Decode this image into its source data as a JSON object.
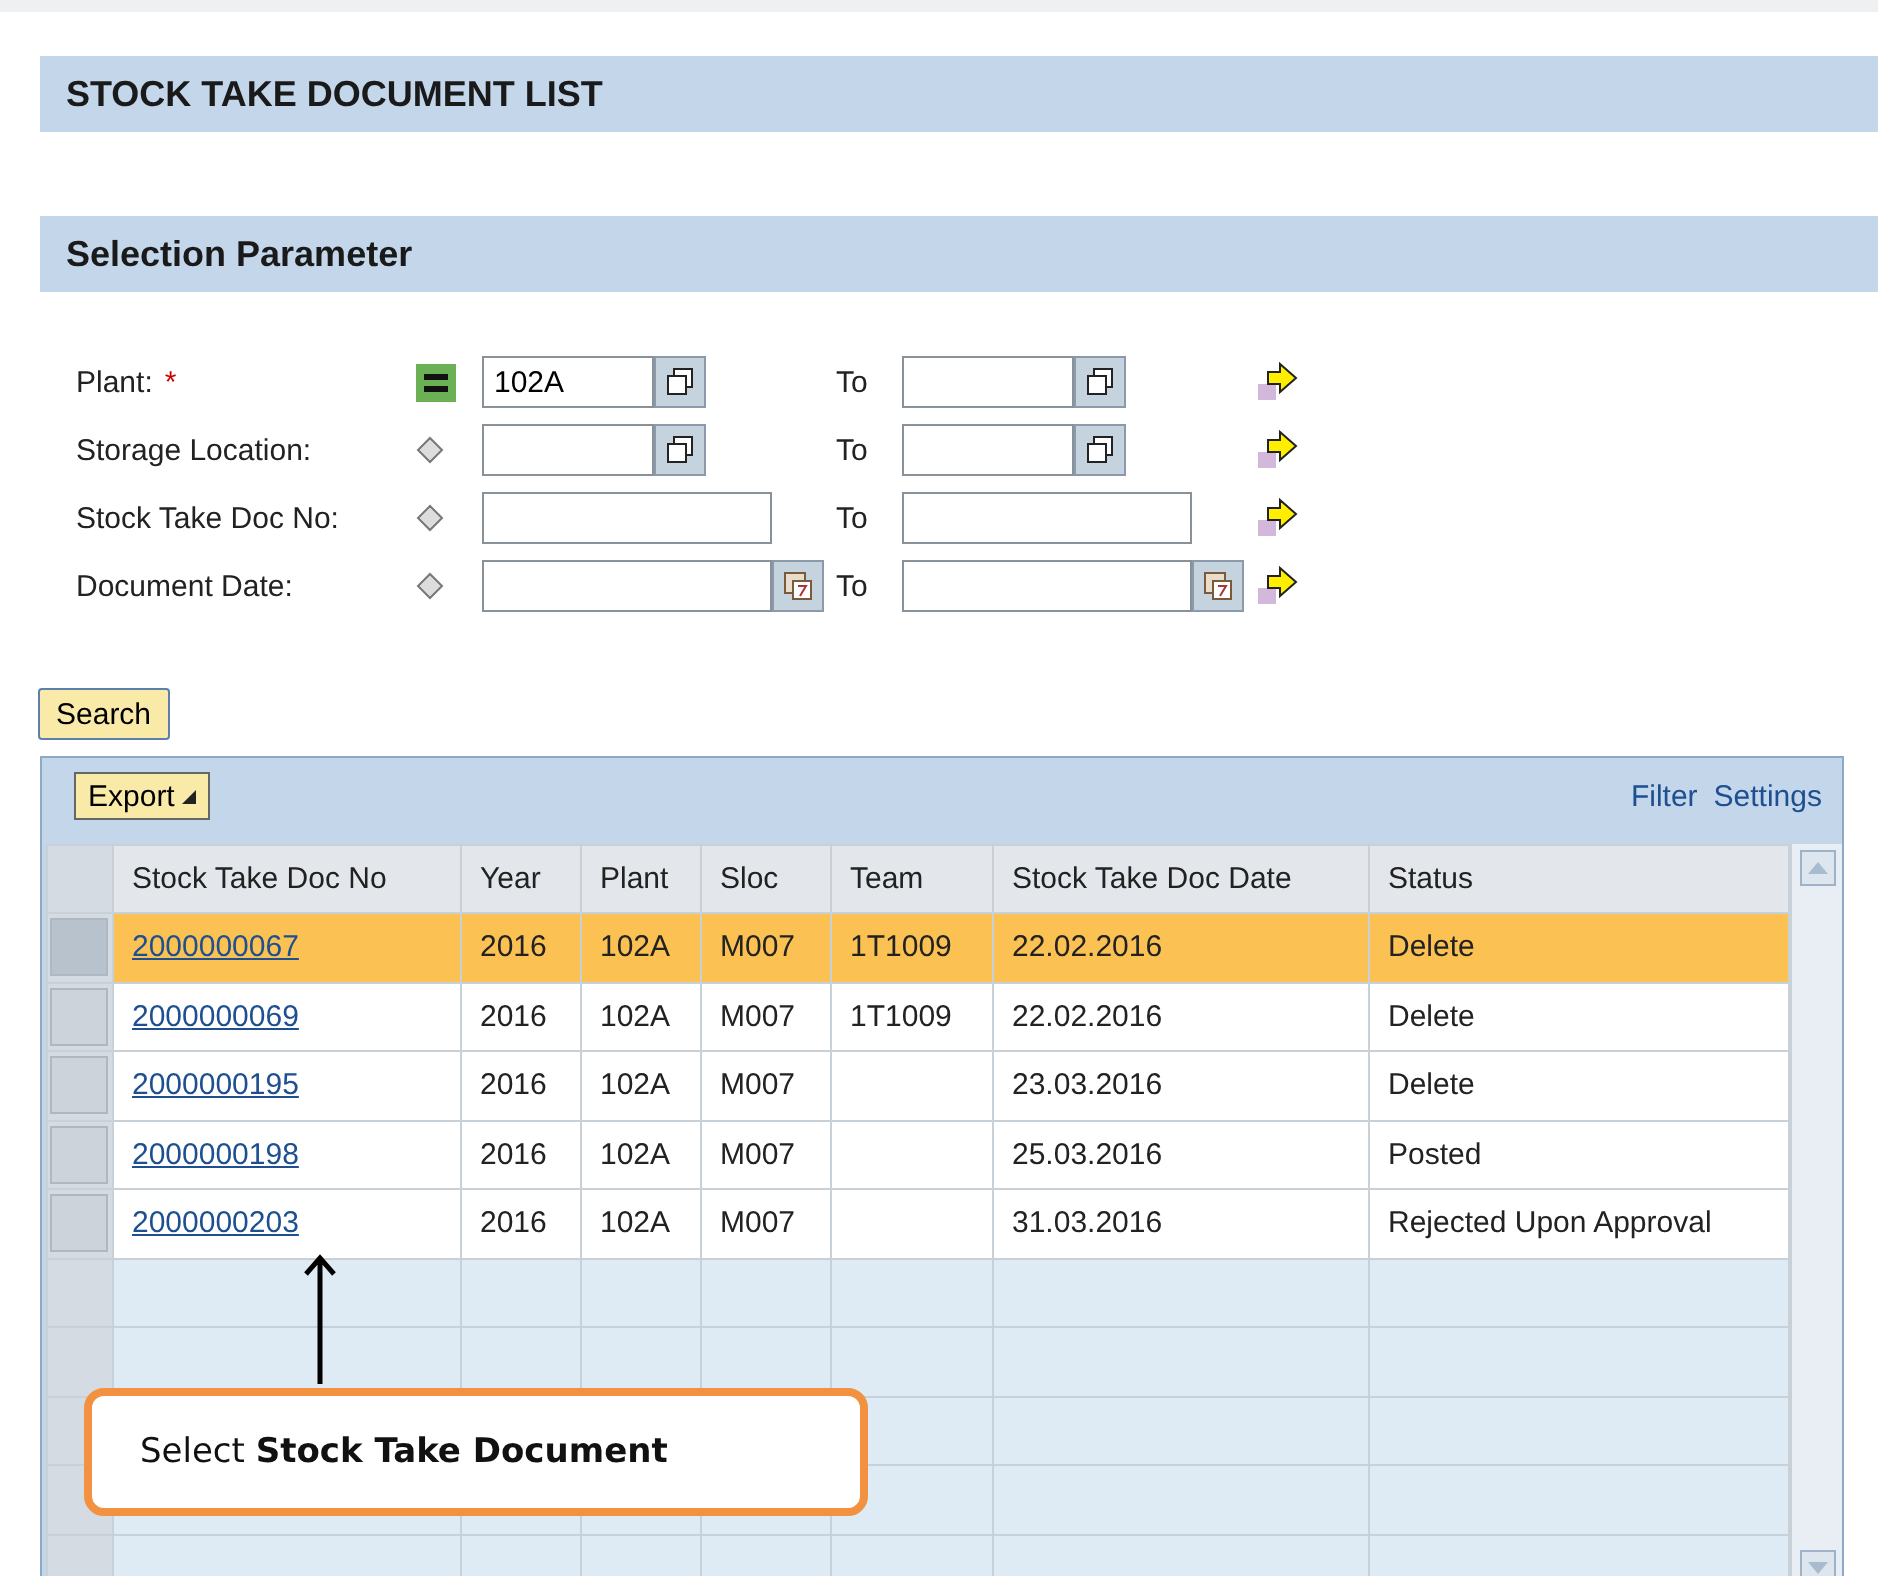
{
  "page_title": "STOCK TAKE DOCUMENT LIST",
  "section_title": "Selection Parameter",
  "parameters": [
    {
      "label": "Plant:",
      "required_mark": "*",
      "operator": {
        "kind": "equal"
      },
      "from": {
        "value": "102A",
        "kind": "multi"
      },
      "to_label": "To",
      "to": {
        "kind": "multi"
      }
    },
    {
      "label": "Storage Location:",
      "operator": {
        "kind": "option"
      },
      "from": {
        "kind": "multi"
      },
      "to_label": "To",
      "to": {
        "kind": "multi"
      }
    },
    {
      "label": "Stock Take Doc No:",
      "operator": {
        "kind": "option"
      },
      "from": {
        "kind": "plain"
      },
      "to_label": "To",
      "to": {
        "kind": "plain"
      }
    },
    {
      "label": "Document Date:",
      "operator": {
        "kind": "option"
      },
      "from": {
        "kind": "calendar"
      },
      "to_label": "To",
      "to": {
        "kind": "calendar"
      }
    }
  ],
  "search_button": "Search",
  "table": {
    "export_button": "Export",
    "toolbar_links": [
      "Filter",
      "Settings"
    ],
    "columns": [
      "Stock Take Doc No",
      "Year",
      "Plant",
      "Sloc",
      "Team",
      "Stock Take Doc Date",
      "Status"
    ],
    "rows": [
      {
        "selected": true,
        "cells": [
          "2000000067",
          "2016",
          "102A",
          "M007",
          "1T1009",
          "22.02.2016",
          "Delete"
        ]
      },
      {
        "selected": false,
        "cells": [
          "2000000069",
          "2016",
          "102A",
          "M007",
          "1T1009",
          "22.02.2016",
          "Delete"
        ]
      },
      {
        "selected": false,
        "cells": [
          "2000000195",
          "2016",
          "102A",
          "M007",
          "",
          "23.03.2016",
          "Delete"
        ]
      },
      {
        "selected": false,
        "cells": [
          "2000000198",
          "2016",
          "102A",
          "M007",
          "",
          "25.03.2016",
          "Posted"
        ]
      },
      {
        "selected": false,
        "cells": [
          "2000000203",
          "2016",
          "102A",
          "M007",
          "",
          "31.03.2016",
          "Rejected Upon Approval"
        ]
      }
    ]
  },
  "callout": "Select **Stock Take Document**"
}
